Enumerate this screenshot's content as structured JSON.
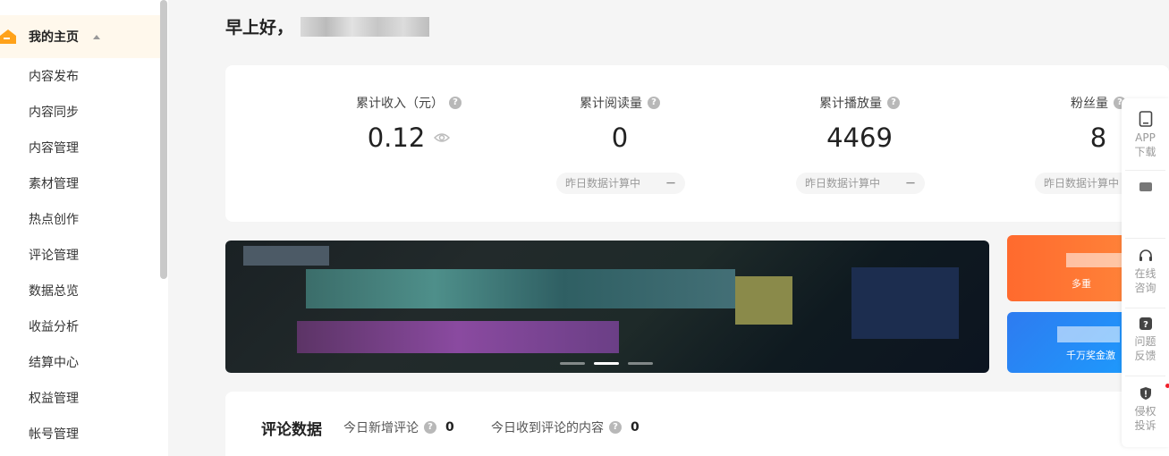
{
  "sidebar": {
    "home": {
      "label": "我的主页",
      "icon": "home-icon"
    },
    "items": [
      {
        "label": "内容发布"
      },
      {
        "label": "内容同步"
      },
      {
        "label": "内容管理"
      },
      {
        "label": "素材管理"
      },
      {
        "label": "热点创作"
      },
      {
        "label": "评论管理"
      },
      {
        "label": "数据总览"
      },
      {
        "label": "收益分析"
      },
      {
        "label": "结算中心"
      },
      {
        "label": "权益管理"
      },
      {
        "label": "帐号管理"
      }
    ]
  },
  "greeting": {
    "prefix": "早上好，"
  },
  "stats": [
    {
      "label": "累计收入（元）",
      "value": "0.12",
      "pill": ""
    },
    {
      "label": "累计阅读量",
      "value": "0",
      "pill": "昨日数据计算中",
      "dash": "－"
    },
    {
      "label": "累计播放量",
      "value": "4469",
      "pill": "昨日数据计算中",
      "dash": "－"
    },
    {
      "label": "粉丝量",
      "value": "8",
      "pill": "昨日数据计算中",
      "dash": "－"
    }
  ],
  "promos": [
    {
      "text": "多重"
    },
    {
      "text": "千万奖金激"
    }
  ],
  "comments": {
    "title": "评论数据",
    "today_new_label": "今日新增评论",
    "today_new_value": "0",
    "today_received_label": "今日收到评论的内容",
    "today_received_value": "0"
  },
  "float_bar": [
    {
      "line1": "APP",
      "line2": "下载",
      "icon": "tablet-icon"
    },
    {
      "line1": "",
      "line2": "",
      "icon": "chat-icon"
    },
    {
      "line1": "在线",
      "line2": "咨询",
      "icon": "headset-icon"
    },
    {
      "line1": "问题",
      "line2": "反馈",
      "icon": "question-icon"
    },
    {
      "line1": "侵权",
      "line2": "投诉",
      "icon": "shield-alert-icon"
    }
  ],
  "colors": {
    "accent": "#ff9f1a",
    "home_bg": "#fff8ec",
    "notice_dot": "#f0202a"
  }
}
